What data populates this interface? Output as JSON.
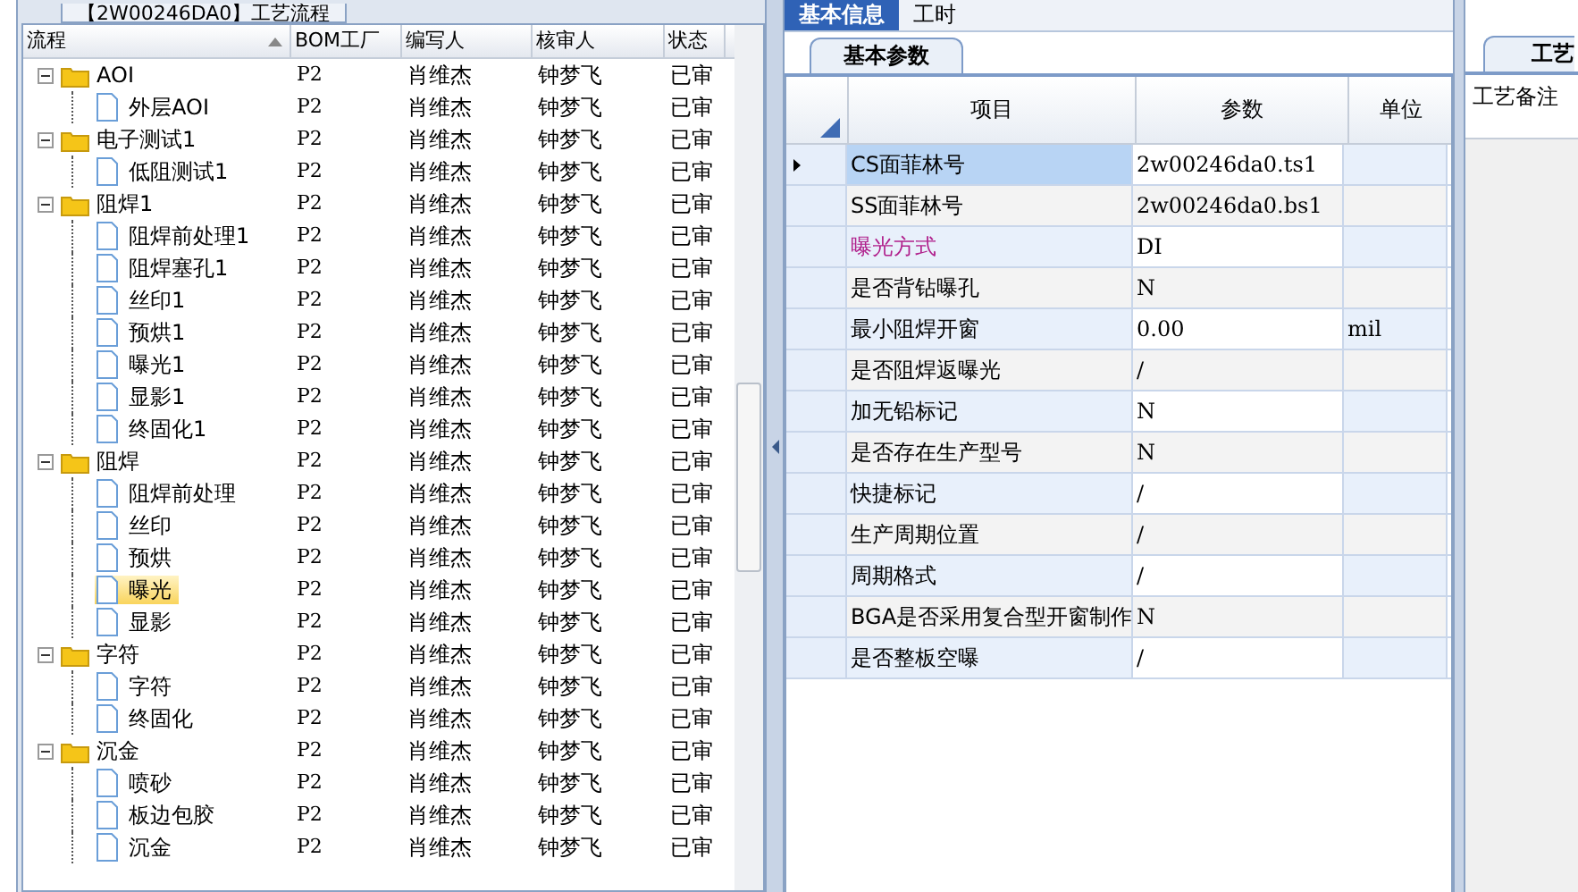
{
  "flow_panel": {
    "title": "【2W00246DA0】工艺流程",
    "columns": [
      "流程",
      "BOM工厂",
      "编写人",
      "核审人",
      "状态"
    ],
    "tree": [
      {
        "name": "AOI",
        "factory": "P2",
        "writer": "肖维杰",
        "reviewer": "钟梦飞",
        "status": "已审",
        "expanded": true,
        "selected": false,
        "children": [
          {
            "name": "外层AOI",
            "factory": "P2",
            "writer": "肖维杰",
            "reviewer": "钟梦飞",
            "status": "已审",
            "selected": false
          }
        ]
      },
      {
        "name": "电子测试1",
        "factory": "P2",
        "writer": "肖维杰",
        "reviewer": "钟梦飞",
        "status": "已审",
        "expanded": true,
        "selected": false,
        "children": [
          {
            "name": "低阻测试1",
            "factory": "P2",
            "writer": "肖维杰",
            "reviewer": "钟梦飞",
            "status": "已审",
            "selected": false
          }
        ]
      },
      {
        "name": "阻焊1",
        "factory": "P2",
        "writer": "肖维杰",
        "reviewer": "钟梦飞",
        "status": "已审",
        "expanded": true,
        "selected": false,
        "children": [
          {
            "name": "阻焊前处理1",
            "factory": "P2",
            "writer": "肖维杰",
            "reviewer": "钟梦飞",
            "status": "已审",
            "selected": false
          },
          {
            "name": "阻焊塞孔1",
            "factory": "P2",
            "writer": "肖维杰",
            "reviewer": "钟梦飞",
            "status": "已审",
            "selected": false
          },
          {
            "name": "丝印1",
            "factory": "P2",
            "writer": "肖维杰",
            "reviewer": "钟梦飞",
            "status": "已审",
            "selected": false
          },
          {
            "name": "预烘1",
            "factory": "P2",
            "writer": "肖维杰",
            "reviewer": "钟梦飞",
            "status": "已审",
            "selected": false
          },
          {
            "name": "曝光1",
            "factory": "P2",
            "writer": "肖维杰",
            "reviewer": "钟梦飞",
            "status": "已审",
            "selected": false
          },
          {
            "name": "显影1",
            "factory": "P2",
            "writer": "肖维杰",
            "reviewer": "钟梦飞",
            "status": "已审",
            "selected": false
          },
          {
            "name": "终固化1",
            "factory": "P2",
            "writer": "肖维杰",
            "reviewer": "钟梦飞",
            "status": "已审",
            "selected": false
          }
        ]
      },
      {
        "name": "阻焊",
        "factory": "P2",
        "writer": "肖维杰",
        "reviewer": "钟梦飞",
        "status": "已审",
        "expanded": true,
        "selected": false,
        "children": [
          {
            "name": "阻焊前处理",
            "factory": "P2",
            "writer": "肖维杰",
            "reviewer": "钟梦飞",
            "status": "已审",
            "selected": false
          },
          {
            "name": "丝印",
            "factory": "P2",
            "writer": "肖维杰",
            "reviewer": "钟梦飞",
            "status": "已审",
            "selected": false
          },
          {
            "name": "预烘",
            "factory": "P2",
            "writer": "肖维杰",
            "reviewer": "钟梦飞",
            "status": "已审",
            "selected": false
          },
          {
            "name": "曝光",
            "factory": "P2",
            "writer": "肖维杰",
            "reviewer": "钟梦飞",
            "status": "已审",
            "selected": true
          },
          {
            "name": "显影",
            "factory": "P2",
            "writer": "肖维杰",
            "reviewer": "钟梦飞",
            "status": "已审",
            "selected": false
          }
        ]
      },
      {
        "name": "字符",
        "factory": "P2",
        "writer": "肖维杰",
        "reviewer": "钟梦飞",
        "status": "已审",
        "expanded": true,
        "selected": false,
        "children": [
          {
            "name": "字符",
            "factory": "P2",
            "writer": "肖维杰",
            "reviewer": "钟梦飞",
            "status": "已审",
            "selected": false
          },
          {
            "name": "终固化",
            "factory": "P2",
            "writer": "肖维杰",
            "reviewer": "钟梦飞",
            "status": "已审",
            "selected": false
          }
        ]
      },
      {
        "name": "沉金",
        "factory": "P2",
        "writer": "肖维杰",
        "reviewer": "钟梦飞",
        "status": "已审",
        "expanded": true,
        "selected": false,
        "children": [
          {
            "name": "喷砂",
            "factory": "P2",
            "writer": "肖维杰",
            "reviewer": "钟梦飞",
            "status": "已审",
            "selected": false
          },
          {
            "name": "板边包胶",
            "factory": "P2",
            "writer": "肖维杰",
            "reviewer": "钟梦飞",
            "status": "已审",
            "selected": false
          },
          {
            "name": "沉金",
            "factory": "P2",
            "writer": "肖维杰",
            "reviewer": "钟梦飞",
            "status": "已审",
            "selected": false
          }
        ]
      }
    ]
  },
  "tabs": [
    {
      "label": "基本信息",
      "selected": true
    },
    {
      "label": "工时",
      "selected": false
    }
  ],
  "params_panel": {
    "tab": "基本参数",
    "columns": [
      "项目",
      "参数",
      "单位"
    ],
    "rows": [
      {
        "item": "CS面菲林号",
        "value": "2w00246da0.ts1",
        "selected": true,
        "emphasized": false
      },
      {
        "item": "SS面菲林号",
        "value": "2w00246da0.bs1",
        "selected": false,
        "emphasized": false
      },
      {
        "item": "曝光方式",
        "value": "DI",
        "selected": false,
        "emphasized": true
      },
      {
        "item": "是否背钻曝孔",
        "value": "N",
        "selected": false,
        "emphasized": false
      },
      {
        "item": "最小阻焊开窗",
        "value": "0.00",
        "unit": "mil",
        "selected": false,
        "emphasized": false
      },
      {
        "item": "是否阻焊返曝光",
        "value": "/",
        "selected": false,
        "emphasized": false
      },
      {
        "item": "加无铅标记",
        "value": "N",
        "selected": false,
        "emphasized": false
      },
      {
        "item": "是否存在生产型号",
        "value": "N",
        "selected": false,
        "emphasized": false
      },
      {
        "item": "快捷标记",
        "value": "/",
        "selected": false,
        "emphasized": false
      },
      {
        "item": "生产周期位置",
        "value": "/",
        "selected": false,
        "emphasized": false
      },
      {
        "item": "周期格式",
        "value": "/",
        "selected": false,
        "emphasized": false
      },
      {
        "item": "BGA是否采用复合型开窗制作",
        "value": "N",
        "selected": false,
        "emphasized": false
      },
      {
        "item": "是否整板空曝",
        "value": "/",
        "selected": false,
        "emphasized": false
      }
    ]
  },
  "notes_panel": {
    "tab": "工艺",
    "label": "工艺备注"
  }
}
